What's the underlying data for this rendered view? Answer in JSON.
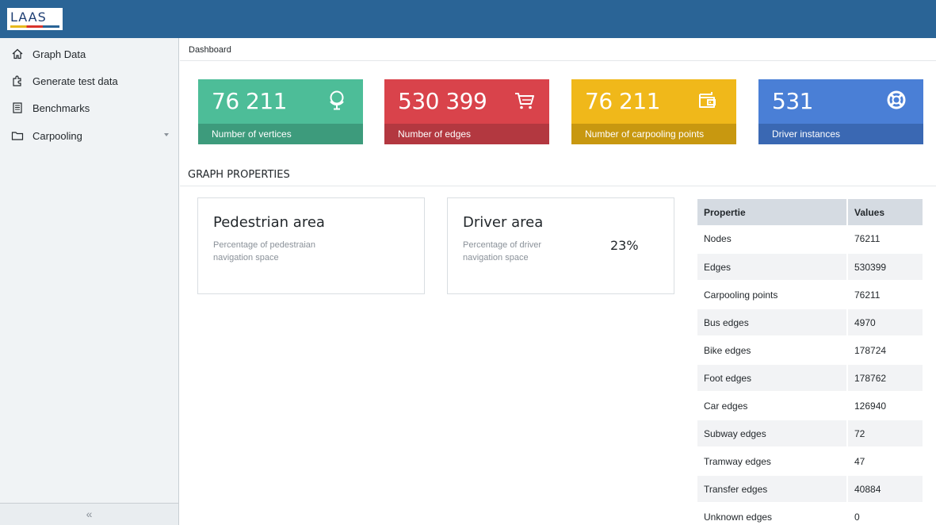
{
  "header": {
    "logo_text": "LAAS"
  },
  "sidebar": {
    "items": [
      {
        "label": "Graph Data",
        "icon": "home-icon"
      },
      {
        "label": "Generate test data",
        "icon": "puzzle-icon"
      },
      {
        "label": "Benchmarks",
        "icon": "document-icon"
      },
      {
        "label": "Carpooling",
        "icon": "folder-icon"
      }
    ],
    "collapse_label": "«"
  },
  "breadcrumb": {
    "label": "Dashboard"
  },
  "cards": [
    {
      "value": "76 211",
      "label": "Number of vertices",
      "icon": "globe-icon",
      "color": "#4dbd98",
      "foot_color": "#3d9b7c"
    },
    {
      "value": "530 399",
      "label": "Number of edges",
      "icon": "cart-icon",
      "color": "#d9434b",
      "foot_color": "#b33840"
    },
    {
      "value": "76 211",
      "label": "Number of carpooling points",
      "icon": "wallet-icon",
      "color": "#f0b81a",
      "foot_color": "#c89810"
    },
    {
      "value": "531",
      "label": "Driver instances",
      "icon": "lifebuoy-icon",
      "color": "#4a7fd6",
      "foot_color": "#3a68b3"
    }
  ],
  "section": {
    "title": "GRAPH PROPERTIES"
  },
  "panels": {
    "pedestrian": {
      "title": "Pedestrian area",
      "subtitle": "Percentage of pedestraian navigation space",
      "value": ""
    },
    "driver": {
      "title": "Driver area",
      "subtitle": "Percentage of driver navigation space",
      "value": "23%"
    }
  },
  "properties_table": {
    "headers": [
      "Propertie",
      "Values"
    ],
    "rows": [
      [
        "Nodes",
        "76211"
      ],
      [
        "Edges",
        "530399"
      ],
      [
        "Carpooling points",
        "76211"
      ],
      [
        "Bus edges",
        "4970"
      ],
      [
        "Bike edges",
        "178724"
      ],
      [
        "Foot edges",
        "178762"
      ],
      [
        "Car edges",
        "126940"
      ],
      [
        "Subway edges",
        "72"
      ],
      [
        "Tramway edges",
        "47"
      ],
      [
        "Transfer edges",
        "40884"
      ],
      [
        "Unknown edges",
        "0"
      ]
    ]
  }
}
